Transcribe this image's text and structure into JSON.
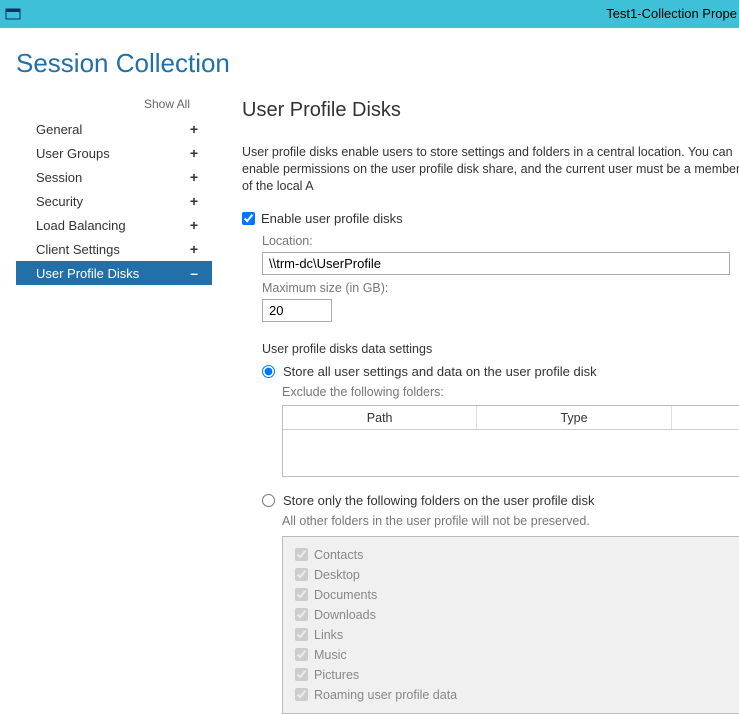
{
  "titlebar": {
    "title": "Test1-Collection Prope"
  },
  "page_title": "Session Collection",
  "sidebar": {
    "show_all": "Show All",
    "items": [
      {
        "label": "General",
        "expand": "+",
        "selected": false
      },
      {
        "label": "User Groups",
        "expand": "+",
        "selected": false
      },
      {
        "label": "Session",
        "expand": "+",
        "selected": false
      },
      {
        "label": "Security",
        "expand": "+",
        "selected": false
      },
      {
        "label": "Load Balancing",
        "expand": "+",
        "selected": false
      },
      {
        "label": "Client Settings",
        "expand": "+",
        "selected": false
      },
      {
        "label": "User Profile Disks",
        "expand": "–",
        "selected": true
      }
    ]
  },
  "content": {
    "heading": "User Profile Disks",
    "description": "User profile disks enable users to store settings and folders in a central location. You can enable permissions on the user profile disk share, and the current user must be a member of the local A",
    "enable_label": "Enable user profile disks",
    "enable_checked": true,
    "location_label": "Location:",
    "location_value": "\\\\trm-dc\\UserProfile",
    "size_label": "Maximum size (in GB):",
    "size_value": "20",
    "data_settings_label": "User profile disks data settings",
    "radio_all_label": "Store all user settings and data on the user profile disk",
    "radio_only_label": "Store only the following folders on the user profile disk",
    "exclude_label": "Exclude the following folders:",
    "col_path": "Path",
    "col_type": "Type",
    "note": "All other folders in the user profile will not be preserved.",
    "folders": [
      "Contacts",
      "Desktop",
      "Documents",
      "Downloads",
      "Links",
      "Music",
      "Pictures",
      "Roaming user profile data"
    ]
  }
}
